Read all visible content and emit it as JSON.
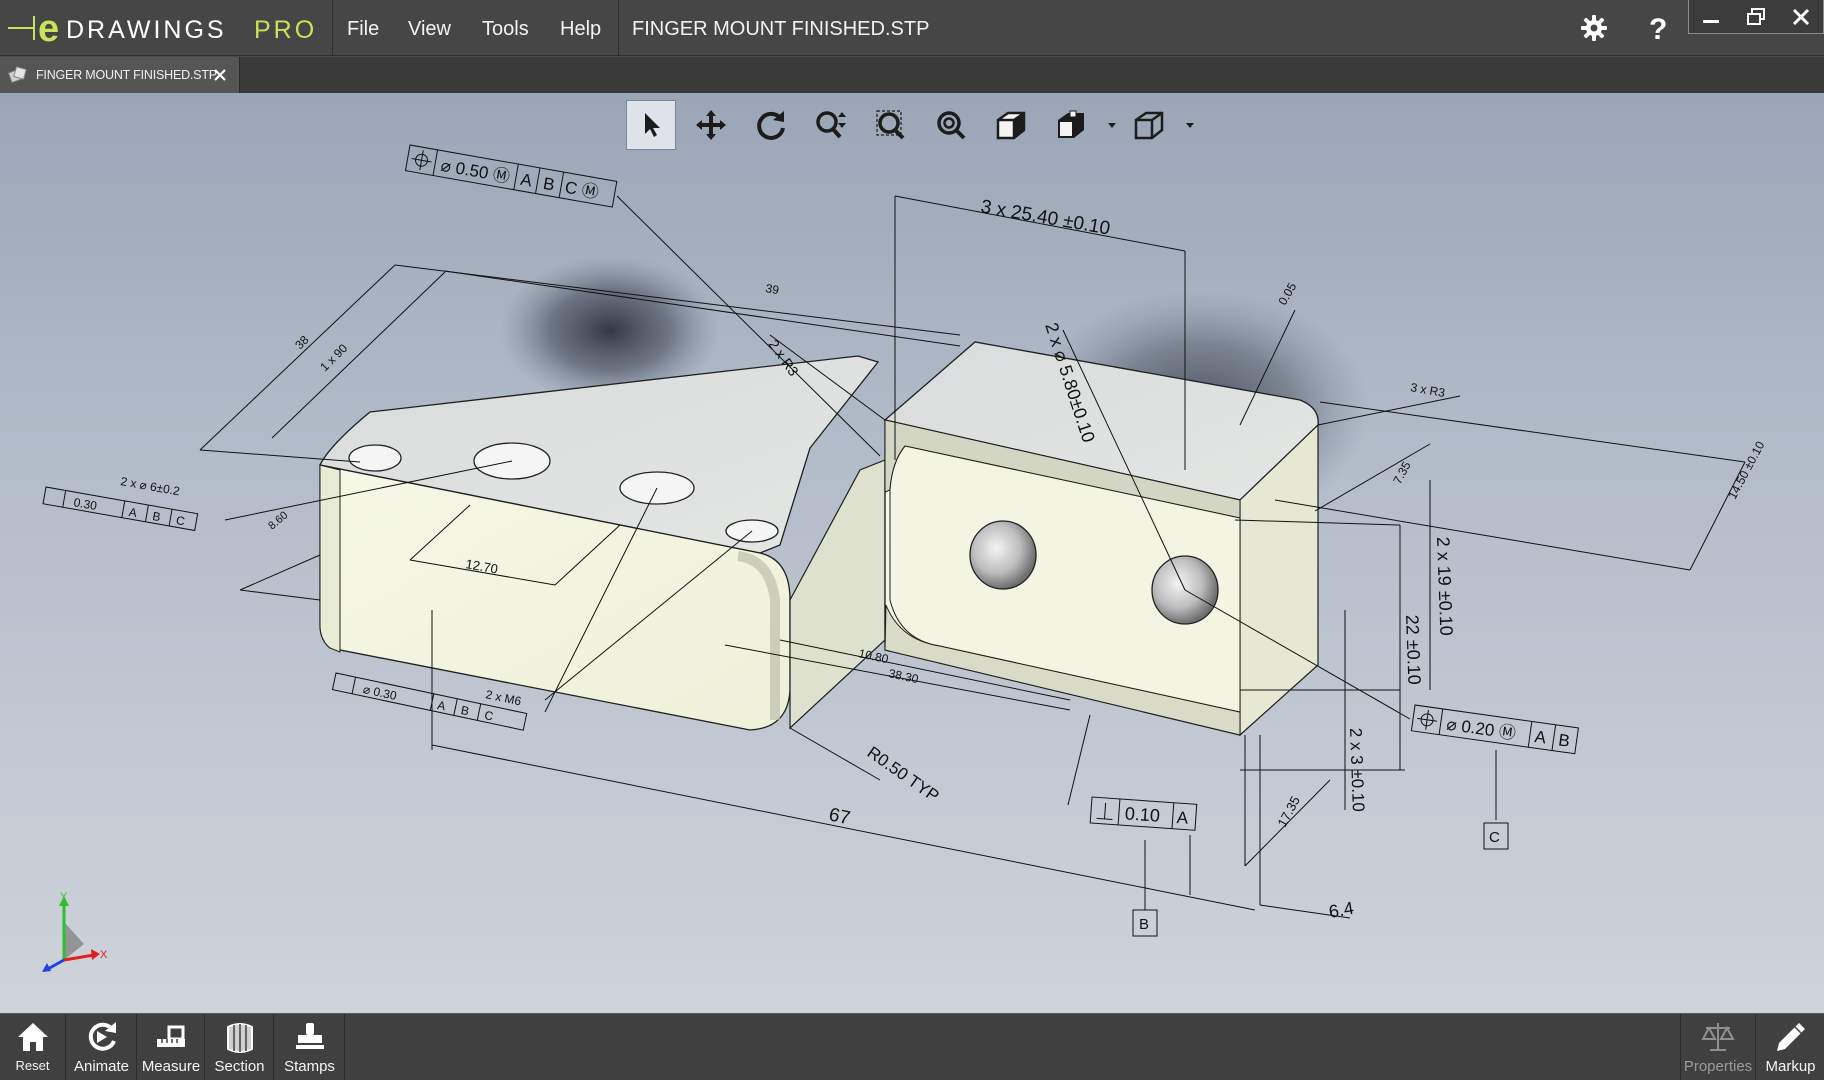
{
  "app": {
    "brand_e": "e",
    "brand_name": "DRAWINGS",
    "brand_edition": "PRO"
  },
  "menu": {
    "file": "File",
    "view": "View",
    "tools": "Tools",
    "help": "Help"
  },
  "document": {
    "title": "FINGER MOUNT FINISHED.STP",
    "tab_label": "FINGER MOUNT FINISHED.STP"
  },
  "header_icons": [
    "gear-icon",
    "help-icon"
  ],
  "window_controls": [
    "minimize-icon",
    "restore-icon",
    "close-icon"
  ],
  "view_toolbar": [
    "select-arrow-icon",
    "pan-icon",
    "rotate-icon",
    "zoom-icon",
    "zoom-window-icon",
    "zoom-to-fit-icon",
    "view-orientation-icon",
    "display-style-icon",
    "standard-views-icon"
  ],
  "annotations": {
    "fcf_top": [
      "⌀ 0.50 Ⓜ",
      "A",
      "B",
      "C Ⓜ"
    ],
    "dim_3x2540": "3 x 25.40 ±0.10",
    "dim_2x580": "2 x ⌀ 5.80±0.10",
    "dim_2xr3": "2 x R3",
    "dim_3xr3": "3 x R3",
    "dim_39": "39",
    "dim_38": "38",
    "dim_1x90": "1 x 90",
    "hole_callout": "2 x ⌀ 6±0.2",
    "fcf_left": [
      "0.30",
      "A",
      "B",
      "C"
    ],
    "dim_12_70": "12.70",
    "dim_left_small": "8.60",
    "fcf_bottom_left": [
      "⌀ 0.30",
      "A",
      "B",
      "C"
    ],
    "thread": "2 x M6",
    "dim_r050": "R0.50 TYP",
    "dim_67": "67",
    "dim_10_80": "10.80",
    "dim_38_30": "38.30",
    "fcf_perp": [
      "0.10",
      "A"
    ],
    "datum_b": "B",
    "datum_c": "C",
    "dim_2x19": "2 x 19 ±0.10",
    "dim_22": "22 ±0.10",
    "dim_2x3": "2 x 3 ±0.10",
    "dim_17_35": "17.35",
    "dim_6_4": "6.4",
    "fcf_right": [
      "⌀ 0.20 Ⓜ",
      "A",
      "B"
    ],
    "dim_14_50": "14.50 ±0.10",
    "flatness": "0.05",
    "dim_7_35": "7.35"
  },
  "triad": {
    "x": "X",
    "y": "Y"
  },
  "bottom_toolbar": {
    "reset": "Reset",
    "animate": "Animate",
    "measure": "Measure",
    "section": "Section",
    "stamps": "Stamps",
    "properties": "Properties",
    "markup": "Markup"
  },
  "colors": {
    "titlebar": "#464646",
    "viewport_top": "#9aa6b6",
    "viewport_bottom": "#cfd3da",
    "part_face": "#f1f3df",
    "accent_green": "#3bbf3b"
  }
}
